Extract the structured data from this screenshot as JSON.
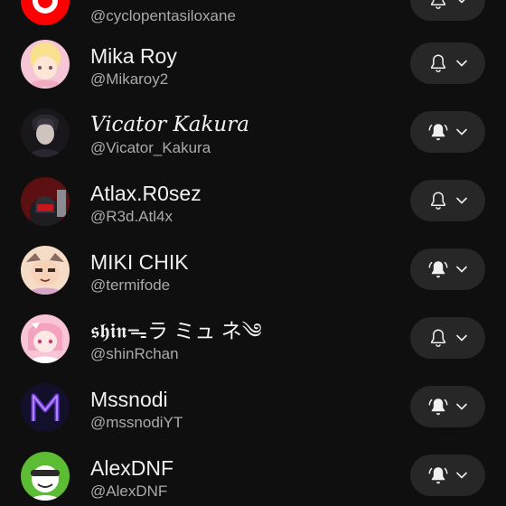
{
  "subscriptions": [
    {
      "name": "",
      "handle": "@cyclopentasiloxane",
      "bell": "bell-outline-icon",
      "avatar_color": "#ff0000"
    },
    {
      "name": "Mika Roy",
      "handle": "@Mikaroy2",
      "bell": "bell-outline-icon",
      "avatar_color": "#f4b3c8"
    },
    {
      "name": "Vicator Kakura",
      "handle": "@Vicator_Kakura",
      "bell": "bell-filled-ringing-icon",
      "avatar_color": "#1e1c20"
    },
    {
      "name": "Atlax.R0sez",
      "handle": "@R3d.Atl4x",
      "bell": "bell-outline-icon",
      "avatar_color": "#7a1618"
    },
    {
      "name": "MIKI CHIK",
      "handle": "@termifode",
      "bell": "bell-filled-ringing-icon",
      "avatar_color": "#f0c8a8"
    },
    {
      "name": "𝖘𝖍𝖎𝖓ᯓラ ミュ ネ༄",
      "handle": "@shinRchan",
      "bell": "bell-outline-icon",
      "avatar_color": "#f7b8cf"
    },
    {
      "name": "Mssnodi",
      "handle": "@mssnodiYT",
      "bell": "bell-filled-ringing-icon",
      "avatar_color": "#14122a"
    },
    {
      "name": "AlexDNF",
      "handle": "@AlexDNF",
      "bell": "bell-filled-ringing-icon",
      "avatar_color": "#6cc43a"
    }
  ]
}
